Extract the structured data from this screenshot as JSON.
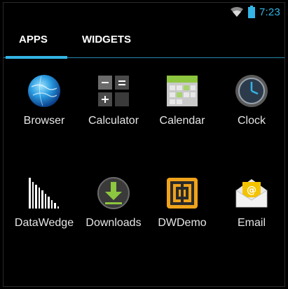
{
  "statusbar": {
    "time": "7:23",
    "icons": [
      "wifi-icon",
      "battery-icon"
    ],
    "accent": "#33b5e5"
  },
  "tabs": [
    {
      "label": "APPS",
      "selected": true
    },
    {
      "label": "WIDGETS",
      "selected": false
    }
  ],
  "apps": [
    {
      "label": "Browser",
      "icon": "globe-icon"
    },
    {
      "label": "Calculator",
      "icon": "calculator-icon"
    },
    {
      "label": "Calendar",
      "icon": "calendar-icon"
    },
    {
      "label": "Clock",
      "icon": "clock-icon"
    },
    {
      "label": "DataWedge",
      "icon": "barcode-icon"
    },
    {
      "label": "Downloads",
      "icon": "download-icon"
    },
    {
      "label": "DWDemo",
      "icon": "dwdemo-icon"
    },
    {
      "label": "Email",
      "icon": "email-icon"
    }
  ]
}
